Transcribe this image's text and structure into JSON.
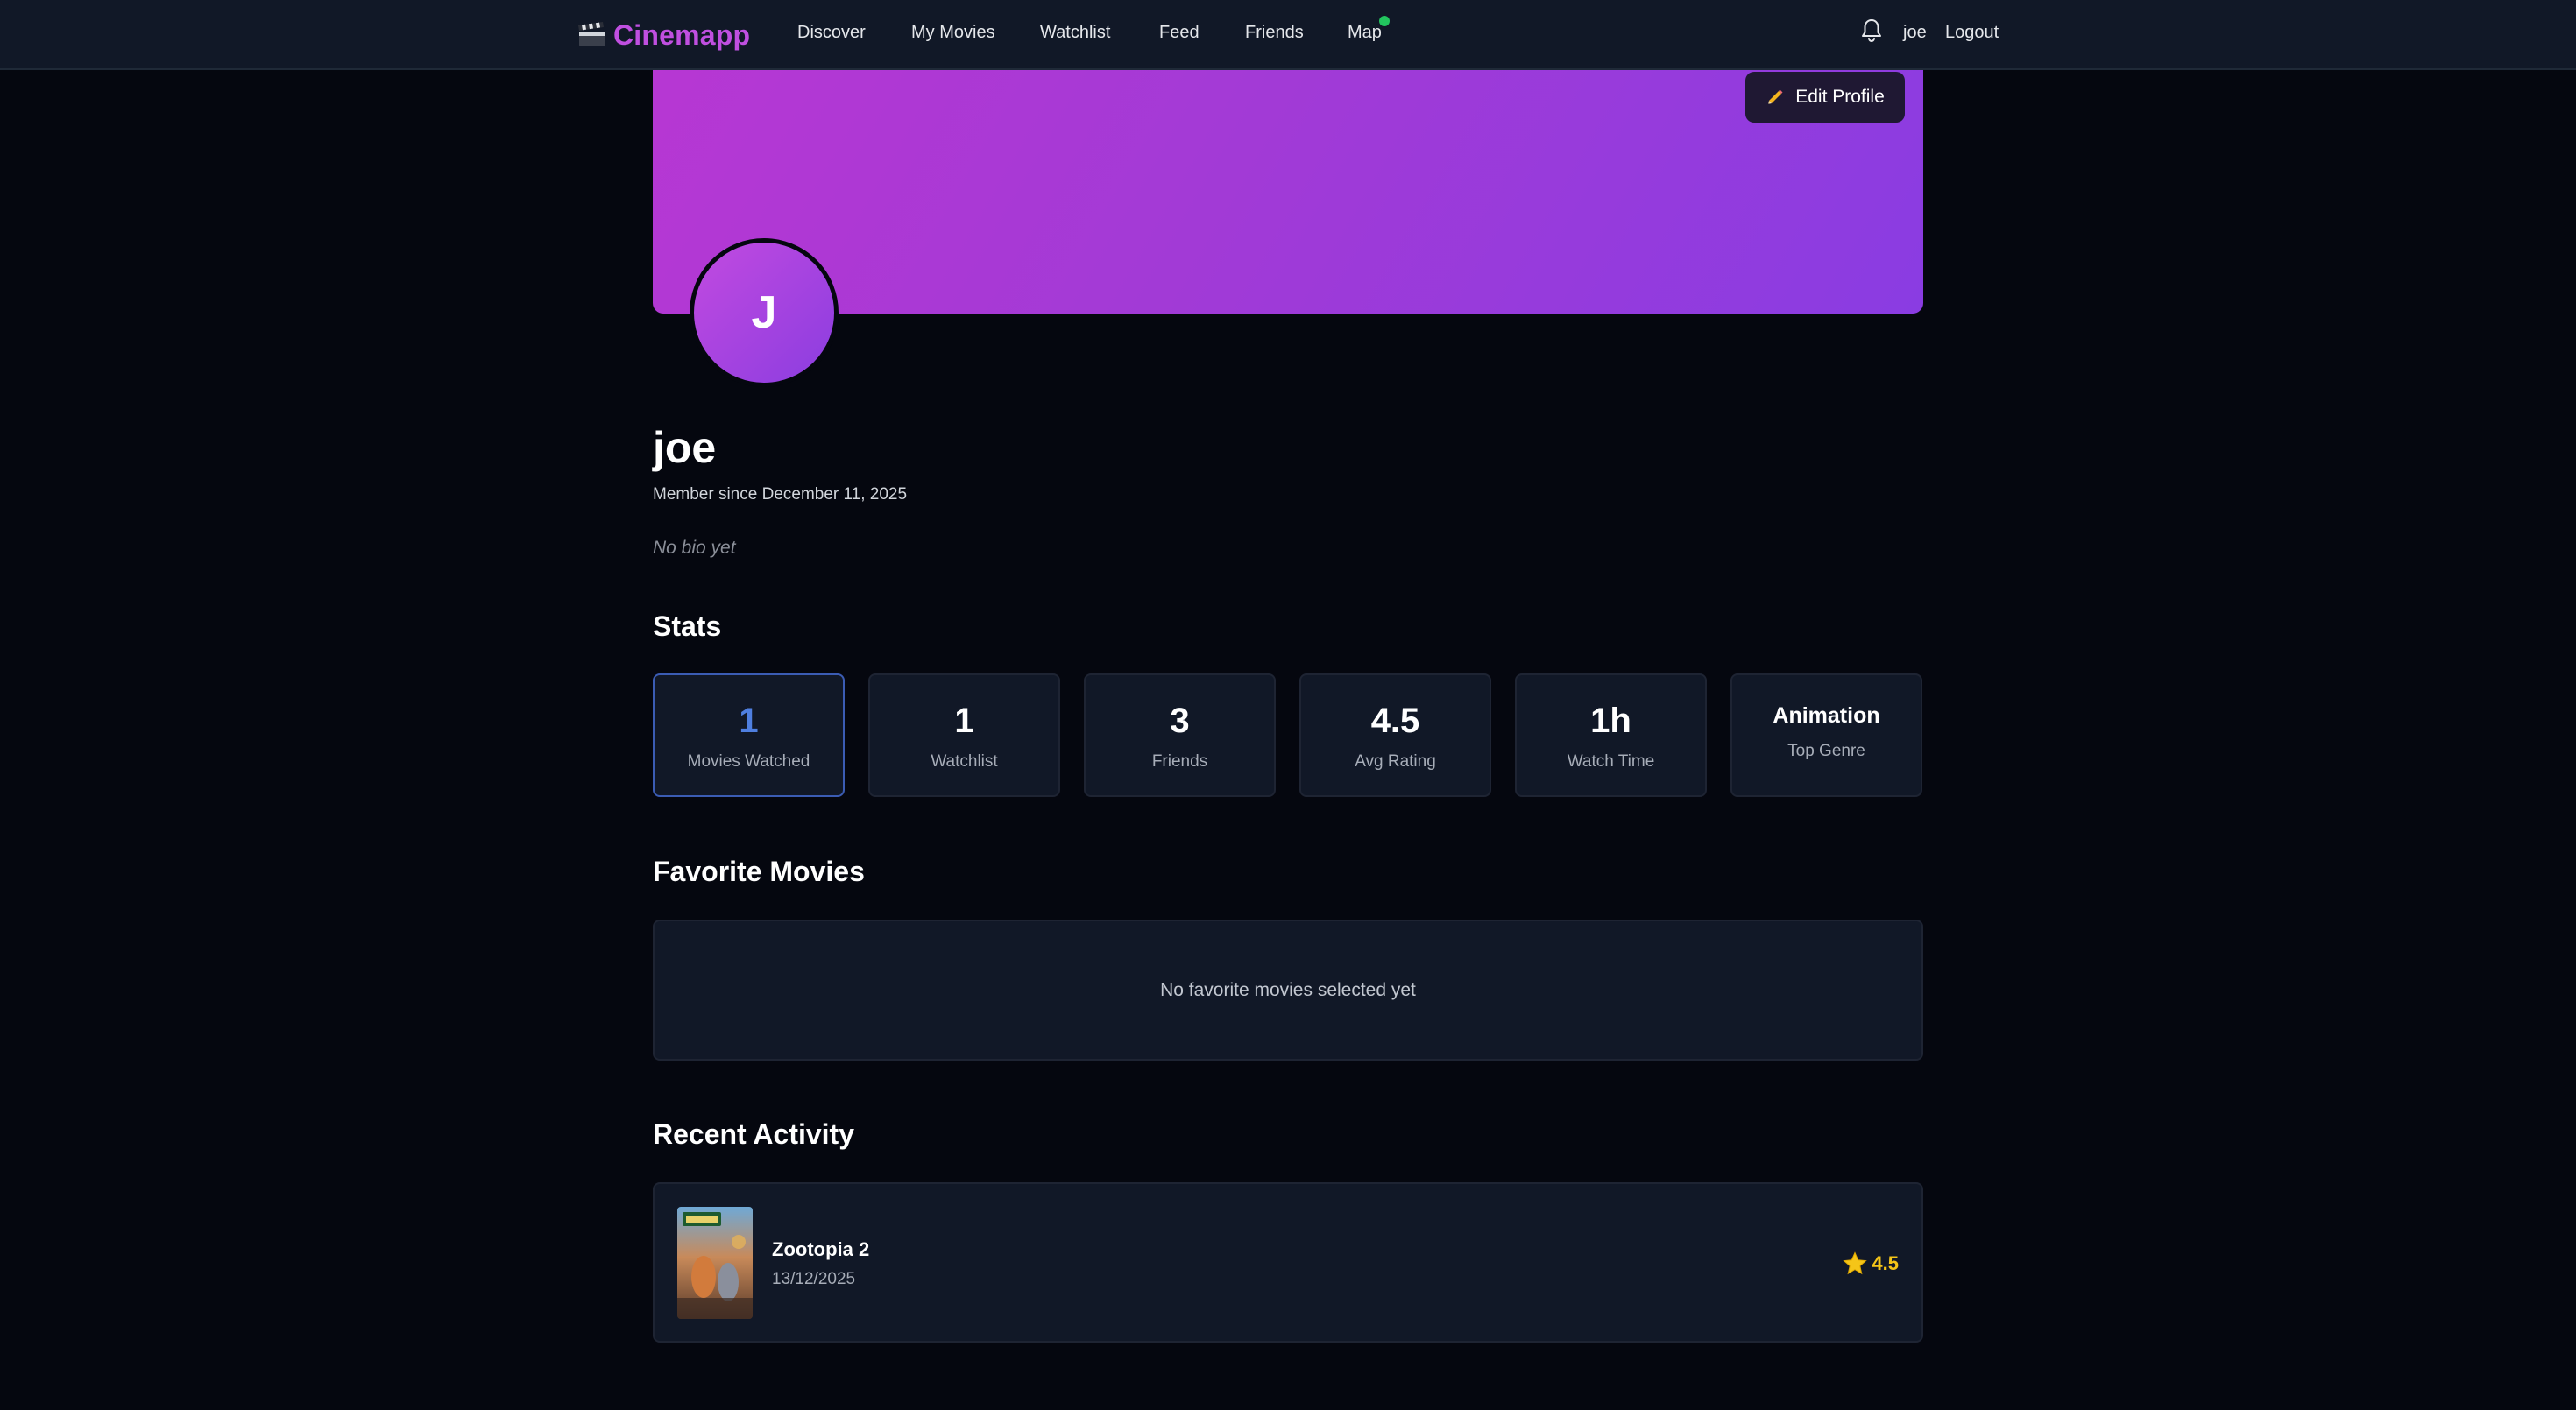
{
  "nav": {
    "brand": "Cinemapp",
    "links": [
      "Discover",
      "My Movies",
      "Watchlist",
      "Feed",
      "Friends",
      "Map"
    ],
    "user": "joe",
    "logout": "Logout",
    "map_status_color": "#22c55e"
  },
  "profile": {
    "edit_label": "Edit Profile",
    "avatar_initial": "J",
    "username": "joe",
    "member_since": "Member since December 11, 2025",
    "bio": "No bio yet"
  },
  "stats": {
    "title": "Stats",
    "items": [
      {
        "value": "1",
        "label": "Movies Watched"
      },
      {
        "value": "1",
        "label": "Watchlist"
      },
      {
        "value": "3",
        "label": "Friends"
      },
      {
        "value": "4.5",
        "label": "Avg Rating"
      },
      {
        "value": "1h",
        "label": "Watch Time"
      },
      {
        "value": "Animation",
        "label": "Top Genre"
      }
    ]
  },
  "favorites": {
    "title": "Favorite Movies",
    "empty": "No favorite movies selected yet"
  },
  "activity": {
    "title": "Recent Activity",
    "items": [
      {
        "title": "Zootopia 2",
        "date": "13/12/2025",
        "rating": "4.5",
        "icon": "star-icon"
      }
    ]
  },
  "colors": {
    "brand": "#c04fe0",
    "banner_start": "#b737d3",
    "banner_end": "#8a3ce2",
    "accent_blue": "#4f7fe0",
    "rating": "#f5c518"
  }
}
